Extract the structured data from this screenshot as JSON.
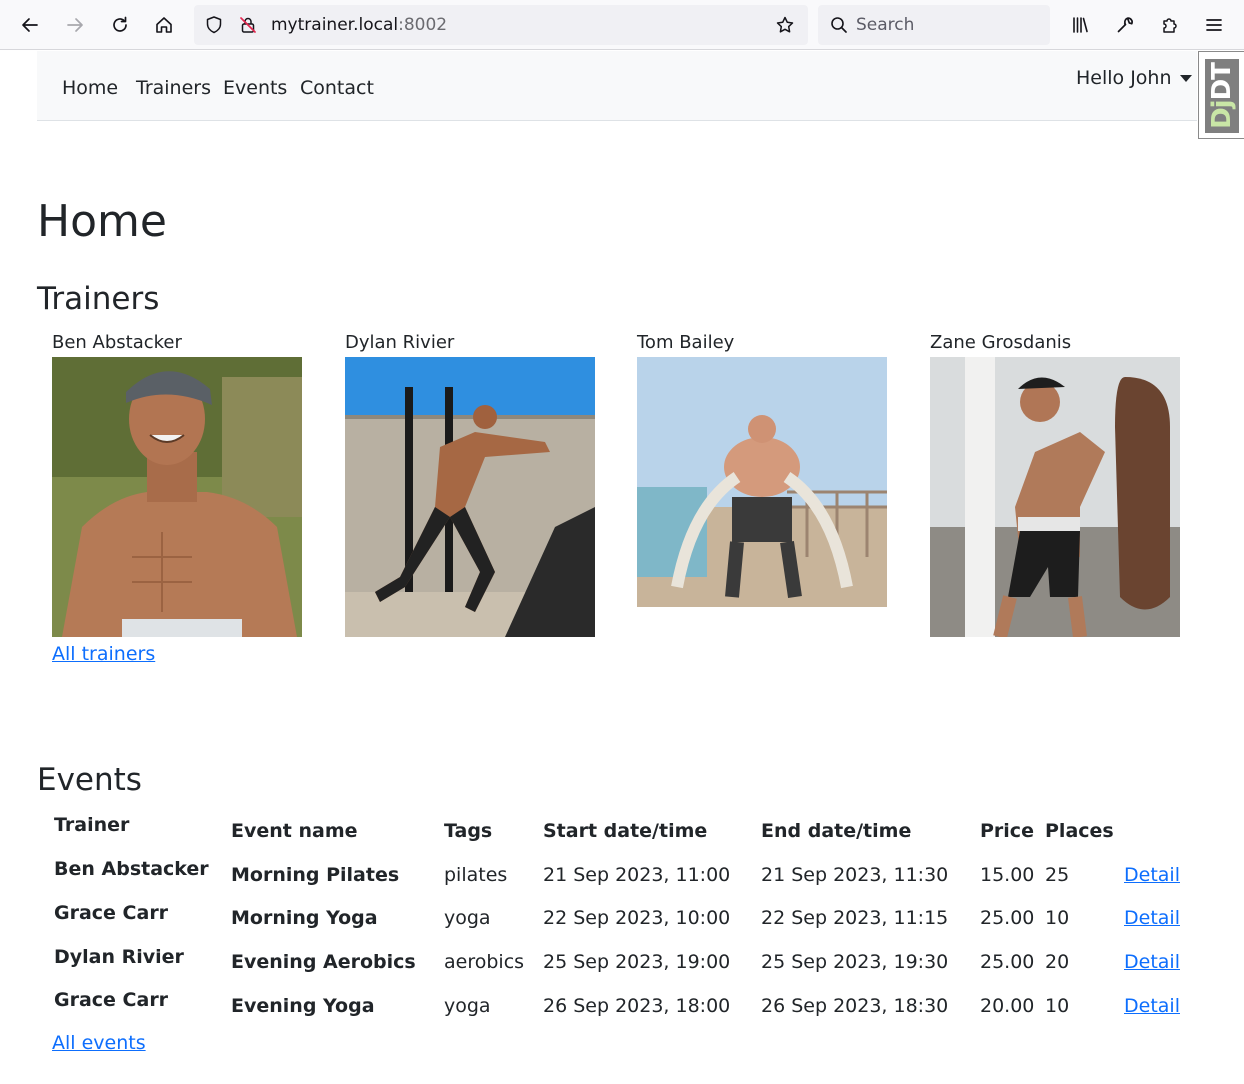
{
  "browser": {
    "url_host": "mytrainer.local",
    "url_port": ":8002",
    "search_placeholder": "Search"
  },
  "navbar": {
    "links": [
      "Home",
      "Trainers",
      "Events",
      "Contact"
    ],
    "user_menu": "Hello John"
  },
  "debug_toolbar": {
    "label_dj": "Dj",
    "label_dt": "DT"
  },
  "page": {
    "title": "Home"
  },
  "trainers": {
    "heading": "Trainers",
    "items": [
      {
        "name": "Ben Abstacker"
      },
      {
        "name": "Dylan Rivier"
      },
      {
        "name": "Tom Bailey"
      },
      {
        "name": "Zane Grosdanis"
      }
    ],
    "all_link": "All trainers"
  },
  "events": {
    "heading": "Events",
    "columns": {
      "trainer": "Trainer",
      "event_name": "Event name",
      "tags": "Tags",
      "start": "Start date/time",
      "end": "End date/time",
      "price": "Price",
      "places": "Places"
    },
    "rows": [
      {
        "trainer": "Ben Abstacker",
        "event_name": "Morning Pilates",
        "tags": "pilates",
        "start": "21 Sep 2023, 11:00",
        "end": "21 Sep 2023, 11:30",
        "price": "15.00",
        "places": "25",
        "detail": "Detail"
      },
      {
        "trainer": "Grace Carr",
        "event_name": "Morning Yoga",
        "tags": "yoga",
        "start": "22 Sep 2023, 10:00",
        "end": "22 Sep 2023, 11:15",
        "price": "25.00",
        "places": "10",
        "detail": "Detail"
      },
      {
        "trainer": "Dylan Rivier",
        "event_name": "Evening Aerobics",
        "tags": "aerobics",
        "start": "25 Sep 2023, 19:00",
        "end": "25 Sep 2023, 19:30",
        "price": "25.00",
        "places": "20",
        "detail": "Detail"
      },
      {
        "trainer": "Grace Carr",
        "event_name": "Evening Yoga",
        "tags": "yoga",
        "start": "26 Sep 2023, 18:00",
        "end": "26 Sep 2023, 18:30",
        "price": "20.00",
        "places": "10",
        "detail": "Detail"
      }
    ],
    "all_link": "All events"
  },
  "colors": {
    "link": "#0d6efd",
    "navbar_bg": "#f8f9fa",
    "text": "#212529"
  }
}
